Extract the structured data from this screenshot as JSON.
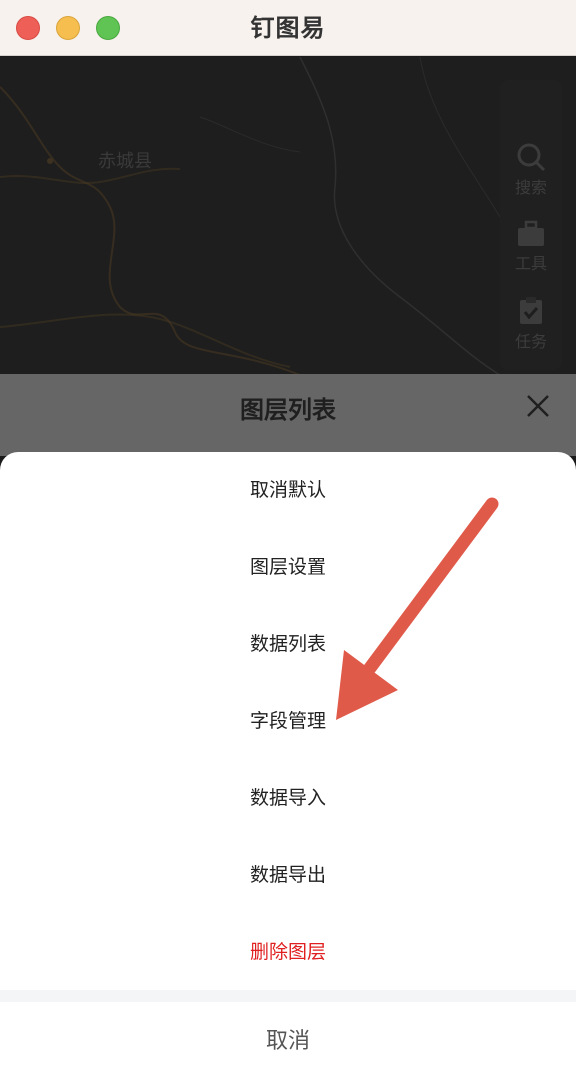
{
  "window": {
    "title": "钉图易"
  },
  "map": {
    "place_label": "赤城县",
    "toolbar": {
      "search_label": "搜索",
      "tools_label": "工具",
      "task_label": "任务"
    }
  },
  "layer_panel": {
    "title": "图层列表"
  },
  "action_sheet": {
    "items": [
      {
        "label": "取消默认"
      },
      {
        "label": "图层设置"
      },
      {
        "label": "数据列表"
      },
      {
        "label": "字段管理"
      },
      {
        "label": "数据导入"
      },
      {
        "label": "数据导出"
      },
      {
        "label": "删除图层"
      }
    ],
    "cancel_label": "取消"
  },
  "colors": {
    "danger": "#e02020",
    "annotation_arrow": "#e05a4a",
    "titlebar_bg": "#f7f2ee"
  }
}
